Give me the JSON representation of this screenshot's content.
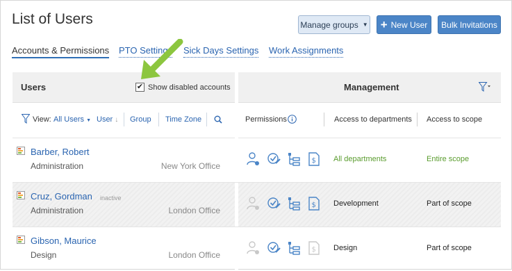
{
  "page": {
    "title": "List of Users"
  },
  "header_buttons": {
    "manage_groups": "Manage groups",
    "new_user": "New User",
    "bulk_invitations": "Bulk Invitations"
  },
  "tabs": [
    {
      "label": "Accounts & Permissions",
      "active": true
    },
    {
      "label": "PTO Settings",
      "active": false
    },
    {
      "label": "Sick Days Settings",
      "active": false
    },
    {
      "label": "Work Assignments",
      "active": false
    }
  ],
  "users_panel": {
    "title": "Users",
    "show_disabled_label": "Show disabled accounts",
    "show_disabled_checked": true,
    "view_label": "View:",
    "view_value": "All Users",
    "sort_user": "User",
    "group": "Group",
    "time_zone": "Time Zone"
  },
  "management_panel": {
    "title": "Management",
    "col_permissions": "Permissions",
    "col_departments": "Access to departments",
    "col_scope": "Access to scope"
  },
  "rows": [
    {
      "name": "Barber, Robert",
      "inactive": "",
      "department": "Administration",
      "office": "New York Office",
      "access_departments": "All departments",
      "access_scope": "Entire scope"
    },
    {
      "name": "Cruz, Gordman",
      "inactive": "inactive",
      "department": "Administration",
      "office": "London Office",
      "access_departments": "Development",
      "access_scope": "Part of scope"
    },
    {
      "name": "Gibson, Maurice",
      "inactive": "",
      "department": "Design",
      "office": "London Office",
      "access_departments": "Design",
      "access_scope": "Part of scope"
    }
  ],
  "colors": {
    "accent": "#4b85c7",
    "link": "#2a64b0",
    "green": "#5a9c2e",
    "arrow": "#8cc63f"
  }
}
